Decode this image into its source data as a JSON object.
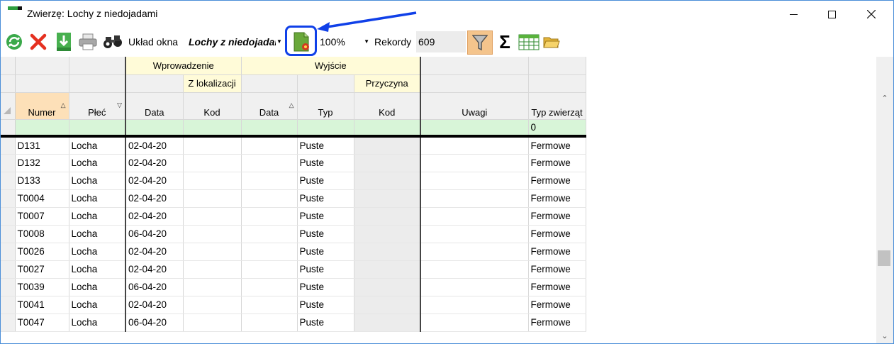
{
  "window": {
    "title": "Zwierzę: Lochy z niedojadami",
    "controls": {
      "minimize": "minimize",
      "maximize": "maximize",
      "close": "close"
    }
  },
  "toolbar": {
    "layout_label": "Układ okna",
    "layout_value": "Lochy z niedojadami",
    "zoom_value": "100%",
    "records_label": "Rekordy",
    "records_value": "609",
    "icons": [
      "refresh-icon",
      "delete-icon",
      "export-icon",
      "print-icon",
      "binoculars-icon",
      "layout-settings-icon",
      "filter-icon",
      "sum-icon",
      "grid-columns-icon",
      "open-folder-icon"
    ],
    "colors": {
      "highlight": "#1040e8",
      "filter_active": "#f4c48c"
    }
  },
  "grid": {
    "group_headers": {
      "wprowadzenie": "Wprowadzenie",
      "wyjscie": "Wyjście",
      "z_lokalizacji": "Z lokalizacji",
      "przyczyna": "Przyczyna"
    },
    "columns": {
      "numer": "Numer",
      "plec": "Płeć",
      "data_in": "Data",
      "kod_in": "Kod",
      "data_out": "Data",
      "typ": "Typ",
      "kod_out": "Kod",
      "uwagi": "Uwagi",
      "typ_zwierzat": "Typ zwierząt"
    },
    "filter_row": {
      "typ_zwierzat": "0"
    },
    "rows": [
      {
        "numer": "D131",
        "plec": "Locha",
        "data": "02-04-20",
        "typ": "Puste",
        "typ_zw": "Fermowe"
      },
      {
        "numer": "D132",
        "plec": "Locha",
        "data": "02-04-20",
        "typ": "Puste",
        "typ_zw": "Fermowe"
      },
      {
        "numer": "D133",
        "plec": "Locha",
        "data": "02-04-20",
        "typ": "Puste",
        "typ_zw": "Fermowe"
      },
      {
        "numer": "T0004",
        "plec": "Locha",
        "data": "02-04-20",
        "typ": "Puste",
        "typ_zw": "Fermowe"
      },
      {
        "numer": "T0007",
        "plec": "Locha",
        "data": "02-04-20",
        "typ": "Puste",
        "typ_zw": "Fermowe"
      },
      {
        "numer": "T0008",
        "plec": "Locha",
        "data": "06-04-20",
        "typ": "Puste",
        "typ_zw": "Fermowe"
      },
      {
        "numer": "T0026",
        "plec": "Locha",
        "data": "02-04-20",
        "typ": "Puste",
        "typ_zw": "Fermowe"
      },
      {
        "numer": "T0027",
        "plec": "Locha",
        "data": "02-04-20",
        "typ": "Puste",
        "typ_zw": "Fermowe"
      },
      {
        "numer": "T0039",
        "plec": "Locha",
        "data": "06-04-20",
        "typ": "Puste",
        "typ_zw": "Fermowe"
      },
      {
        "numer": "T0041",
        "plec": "Locha",
        "data": "02-04-20",
        "typ": "Puste",
        "typ_zw": "Fermowe"
      },
      {
        "numer": "T0047",
        "plec": "Locha",
        "data": "06-04-20",
        "typ": "Puste",
        "typ_zw": "Fermowe"
      }
    ]
  }
}
